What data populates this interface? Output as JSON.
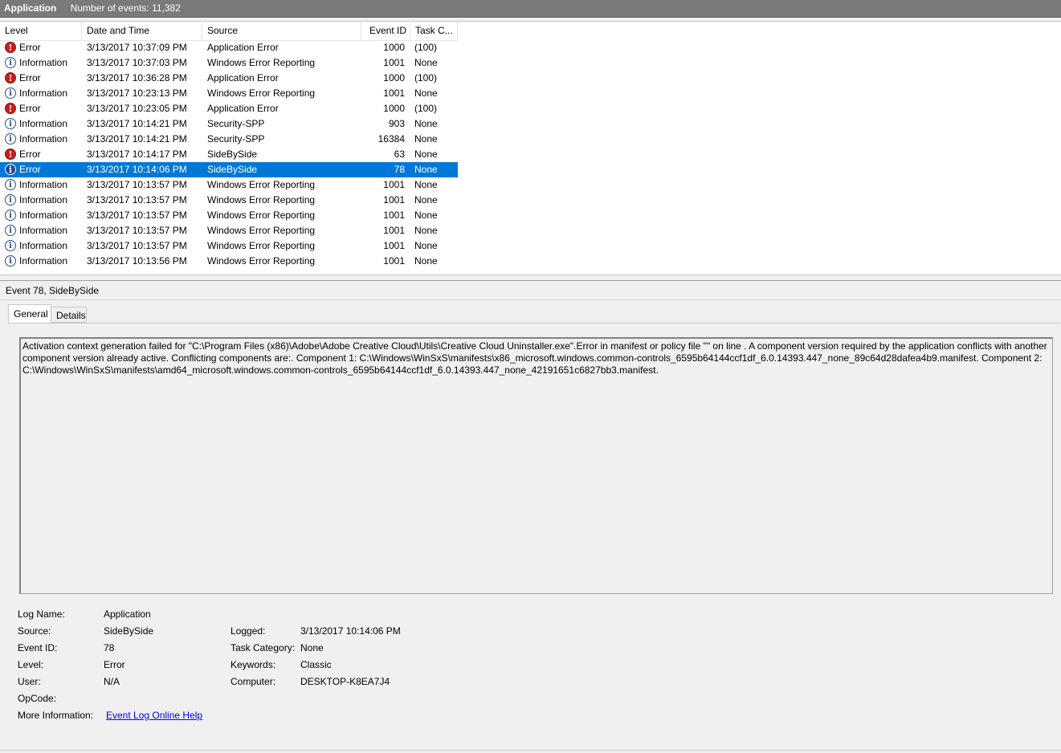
{
  "header": {
    "app": "Application",
    "count_text": "Number of events: 11,382"
  },
  "columns": {
    "level": "Level",
    "date": "Date and Time",
    "source": "Source",
    "event_id": "Event ID",
    "task": "Task C..."
  },
  "rows": [
    {
      "level": "Error",
      "date": "3/13/2017 10:37:09 PM",
      "source": "Application Error",
      "id": "1000",
      "task": "(100)",
      "icon": "error-icon"
    },
    {
      "level": "Information",
      "date": "3/13/2017 10:37:03 PM",
      "source": "Windows Error Reporting",
      "id": "1001",
      "task": "None",
      "icon": "info-icon"
    },
    {
      "level": "Error",
      "date": "3/13/2017 10:36:28 PM",
      "source": "Application Error",
      "id": "1000",
      "task": "(100)",
      "icon": "error-icon"
    },
    {
      "level": "Information",
      "date": "3/13/2017 10:23:13 PM",
      "source": "Windows Error Reporting",
      "id": "1001",
      "task": "None",
      "icon": "info-icon"
    },
    {
      "level": "Error",
      "date": "3/13/2017 10:23:05 PM",
      "source": "Application Error",
      "id": "1000",
      "task": "(100)",
      "icon": "error-icon"
    },
    {
      "level": "Information",
      "date": "3/13/2017 10:14:21 PM",
      "source": "Security-SPP",
      "id": "903",
      "task": "None",
      "icon": "info-icon"
    },
    {
      "level": "Information",
      "date": "3/13/2017 10:14:21 PM",
      "source": "Security-SPP",
      "id": "16384",
      "task": "None",
      "icon": "info-icon"
    },
    {
      "level": "Error",
      "date": "3/13/2017 10:14:17 PM",
      "source": "SideBySide",
      "id": "63",
      "task": "None",
      "icon": "error-icon"
    },
    {
      "level": "Error",
      "date": "3/13/2017 10:14:06 PM",
      "source": "SideBySide",
      "id": "78",
      "task": "None",
      "icon": "error-icon",
      "selected": true
    },
    {
      "level": "Information",
      "date": "3/13/2017 10:13:57 PM",
      "source": "Windows Error Reporting",
      "id": "1001",
      "task": "None",
      "icon": "info-icon"
    },
    {
      "level": "Information",
      "date": "3/13/2017 10:13:57 PM",
      "source": "Windows Error Reporting",
      "id": "1001",
      "task": "None",
      "icon": "info-icon"
    },
    {
      "level": "Information",
      "date": "3/13/2017 10:13:57 PM",
      "source": "Windows Error Reporting",
      "id": "1001",
      "task": "None",
      "icon": "info-icon"
    },
    {
      "level": "Information",
      "date": "3/13/2017 10:13:57 PM",
      "source": "Windows Error Reporting",
      "id": "1001",
      "task": "None",
      "icon": "info-icon"
    },
    {
      "level": "Information",
      "date": "3/13/2017 10:13:57 PM",
      "source": "Windows Error Reporting",
      "id": "1001",
      "task": "None",
      "icon": "info-icon"
    },
    {
      "level": "Information",
      "date": "3/13/2017 10:13:56 PM",
      "source": "Windows Error Reporting",
      "id": "1001",
      "task": "None",
      "icon": "info-icon"
    }
  ],
  "detail": {
    "title": "Event 78, SideBySide",
    "tabs": {
      "general": "General",
      "details": "Details"
    },
    "message": "Activation context generation failed for \"C:\\Program Files (x86)\\Adobe\\Adobe Creative Cloud\\Utils\\Creative Cloud Uninstaller.exe\".Error in manifest or policy file \"\" on line . A component version required by the application conflicts with another component version already active. Conflicting components are:. Component 1: C:\\Windows\\WinSxS\\manifests\\x86_microsoft.windows.common-controls_6595b64144ccf1df_6.0.14393.447_none_89c64d28dafea4b9.manifest. Component 2: C:\\Windows\\WinSxS\\manifests\\amd64_microsoft.windows.common-controls_6595b64144ccf1df_6.0.14393.447_none_42191651c6827bb3.manifest.",
    "labels": {
      "log_name": "Log Name:",
      "source": "Source:",
      "event_id": "Event ID:",
      "level": "Level:",
      "user": "User:",
      "opcode": "OpCode:",
      "more_info": "More Information:",
      "logged": "Logged:",
      "task_category": "Task Category:",
      "keywords": "Keywords:",
      "computer": "Computer:"
    },
    "values": {
      "log_name": "Application",
      "source": "SideBySide",
      "event_id": "78",
      "level": "Error",
      "user": "N/A",
      "opcode": "",
      "more_info_link": "Event Log Online Help",
      "logged": "3/13/2017 10:14:06 PM",
      "task_category": "None",
      "keywords": "Classic",
      "computer": "DESKTOP-K8EA7J4"
    }
  }
}
